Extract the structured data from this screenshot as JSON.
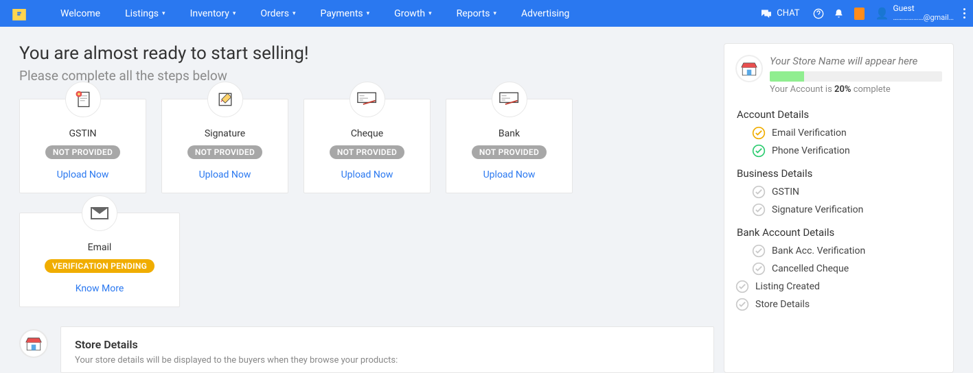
{
  "nav": {
    "welcome": "Welcome",
    "items": [
      "Listings",
      "Inventory",
      "Orders",
      "Payments",
      "Growth",
      "Reports"
    ],
    "advertising": "Advertising",
    "chat": "CHAT",
    "user": {
      "name": "Guest",
      "email": "………………@gmail…"
    }
  },
  "main": {
    "title": "You are almost ready to start selling!",
    "subtitle": "Please complete all the steps below",
    "cards": [
      {
        "title": "GSTIN",
        "status": "NOT PROVIDED",
        "action": "Upload Now",
        "pill": "gray",
        "icon": "document"
      },
      {
        "title": "Signature",
        "status": "NOT PROVIDED",
        "action": "Upload Now",
        "pill": "gray",
        "icon": "signature"
      },
      {
        "title": "Cheque",
        "status": "NOT PROVIDED",
        "action": "Upload Now",
        "pill": "gray",
        "icon": "cheque"
      },
      {
        "title": "Bank",
        "status": "NOT PROVIDED",
        "action": "Upload Now",
        "pill": "gray",
        "icon": "bank"
      }
    ],
    "email_card": {
      "title": "Email",
      "status": "VERIFICATION PENDING",
      "action": "Know More",
      "pill": "yellow"
    },
    "store_details": {
      "heading": "Store Details",
      "desc": "Your store details will be displayed to the buyers when they browse your products:"
    }
  },
  "side": {
    "store_name": "Your Store Name will appear here",
    "progress_pct": 20,
    "progress_prefix": "Your Account is ",
    "progress_suffix": " complete",
    "sections": [
      {
        "title": "Account Details",
        "items": [
          {
            "label": "Email Verification",
            "state": "warn"
          },
          {
            "label": "Phone Verification",
            "state": "done"
          }
        ]
      },
      {
        "title": "Business Details",
        "items": [
          {
            "label": "GSTIN",
            "state": "pending"
          },
          {
            "label": "Signature Verification",
            "state": "pending"
          }
        ]
      },
      {
        "title": "Bank Account Details",
        "items": [
          {
            "label": "Bank Acc. Verification",
            "state": "pending"
          },
          {
            "label": "Cancelled Cheque",
            "state": "pending"
          }
        ]
      }
    ],
    "tail": [
      {
        "label": "Listing Created",
        "state": "pending"
      },
      {
        "label": "Store Details",
        "state": "pending"
      }
    ]
  }
}
